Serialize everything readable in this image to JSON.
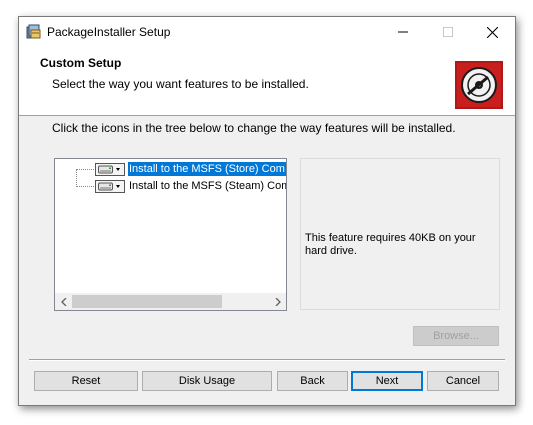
{
  "window": {
    "title": "PackageInstaller Setup",
    "controls": {
      "minimize_icon": "minimize-icon",
      "maximize_icon": "maximize-icon",
      "close_icon": "close-icon"
    }
  },
  "header": {
    "title": "Custom Setup",
    "subtitle": "Select the way you want features to be installed.",
    "logo_icon": "disc-icon",
    "logo_color": "#b01818"
  },
  "instruction": "Click the icons in the tree below to change the way features will be installed.",
  "tree": {
    "items": [
      {
        "label": "Install to the MSFS (Store) Com",
        "selected": true,
        "icon": "drive-icon"
      },
      {
        "label": "Install to the MSFS (Steam) Com",
        "selected": false,
        "icon": "drive-icon"
      }
    ],
    "scroll_left_icon": "scroll-left-icon",
    "scroll_right_icon": "scroll-right-icon"
  },
  "description": {
    "text": "This feature requires 40KB on your hard drive."
  },
  "buttons": {
    "browse": "Browse...",
    "reset": "Reset",
    "disk_usage": "Disk Usage",
    "back": "Back",
    "next": "Next",
    "cancel": "Cancel"
  },
  "colors": {
    "selection": "#0078d7",
    "window_bg": "#f0f0f0"
  }
}
